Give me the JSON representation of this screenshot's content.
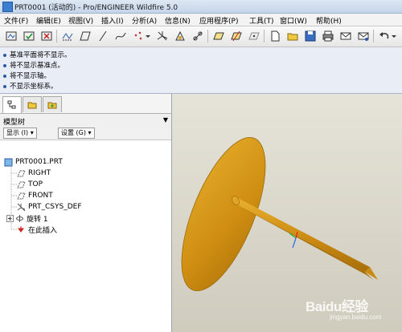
{
  "window": {
    "title": "PRT0001 (活动的) - Pro/ENGINEER Wildfire 5.0"
  },
  "menu": [
    {
      "label": "文件(F)"
    },
    {
      "label": "编辑(E)"
    },
    {
      "label": "视图(V)"
    },
    {
      "label": "插入(I)"
    },
    {
      "label": "分析(A)"
    },
    {
      "label": "信息(N)"
    },
    {
      "label": "应用程序(P)"
    },
    {
      "label": "工具(T)"
    },
    {
      "label": "窗口(W)"
    },
    {
      "label": "帮助(H)"
    }
  ],
  "messages": [
    "基准平面将不显示。",
    "将不显示基准点。",
    "将不显示轴。",
    "不显示坐标系。"
  ],
  "model_tree": {
    "title": "模型树",
    "show_label": "显示 (I)",
    "settings_label": "设置 (G)",
    "nodes": [
      {
        "label": "PRT0001.PRT"
      },
      {
        "label": "RIGHT"
      },
      {
        "label": "TOP"
      },
      {
        "label": "FRONT"
      },
      {
        "label": "PRT_CSYS_DEF"
      },
      {
        "label": "旋转 1"
      },
      {
        "label": "在此插入"
      }
    ]
  },
  "watermark": {
    "brand": "Baidu经验",
    "url": "jingyan.baidu.com"
  },
  "colors": {
    "model": "#d89b18",
    "background": "#dcd9ce",
    "accent": "#2a5aa8"
  }
}
